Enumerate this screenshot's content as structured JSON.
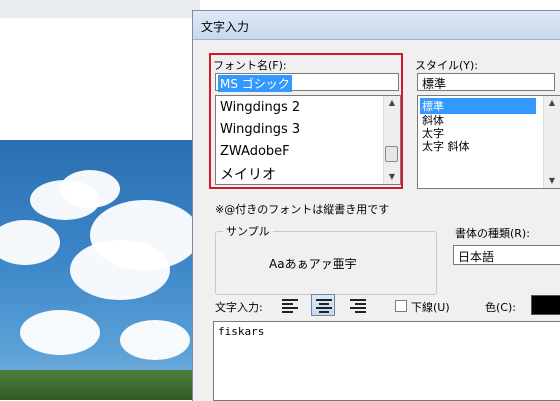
{
  "dialog": {
    "title": "文字入力",
    "font_label": "フォント名(F):",
    "font_value": "MS ゴシック",
    "font_list": [
      "Wingdings 2",
      "Wingdings 3",
      "ZWAdobeF",
      "メイリオ"
    ],
    "style_label": "スタイル(Y):",
    "style_value": "標準",
    "style_list": [
      "標準",
      "斜体",
      "太字",
      "太字 斜体"
    ],
    "note": "※@付きのフォントは縦書き用です",
    "sample_label": "サンプル",
    "sample_text": "Aaあぁアァ亜宇",
    "script_label": "書体の種類(R):",
    "script_value": "日本語",
    "text_input_label": "文字入力:",
    "underline_label": "下線(U)",
    "color_label": "色(C):",
    "text_value": "fiskars",
    "colors": {
      "color_swatch": "#000000",
      "highlight": "#3399ff",
      "red_frame": "#d01b2a"
    }
  }
}
